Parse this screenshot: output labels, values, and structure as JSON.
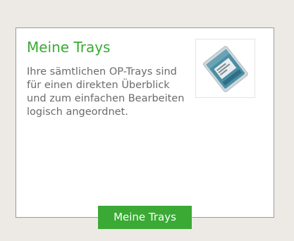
{
  "card": {
    "title": "Meine Trays",
    "description": "Ihre sämtlichen OP-Trays sind für einen direkten Überblick und zum einfachen Bearbeiten logisch angeordnet.",
    "image": {
      "icon": "surgical-tray-package-icon"
    },
    "button_label": "Meine Trays"
  },
  "colors": {
    "accent": "#3aaa35",
    "page_background": "#edeae6",
    "card_border": "#9a9a9a",
    "body_text": "#6b6b6b",
    "package_blue": "#4c8ea4"
  }
}
